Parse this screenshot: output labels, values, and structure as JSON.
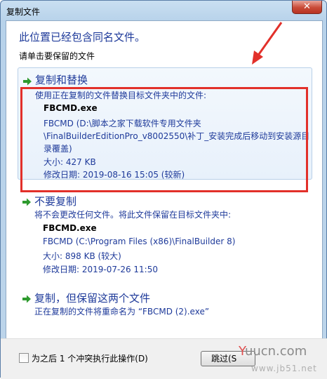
{
  "window": {
    "title": "复制文件",
    "close_glyph": "✕"
  },
  "heading": "此位置已经包含同名文件。",
  "subheading": "请单击要保留的文件",
  "options": [
    {
      "title": "复制和替换",
      "desc": "使用正在复制的文件替换目标文件夹中的文件:",
      "filename": "FBCMD.exe",
      "path_lines": [
        "FBCMD (D:\\脚本之家下载软件专用文件夹",
        "\\FinalBuilderEditionPro_v8002550\\补丁_安装完成后移动到安装源目",
        "录覆盖)"
      ],
      "size": "大小: 427 KB",
      "date": "修改日期: 2019-08-16 15:05 (较新)"
    },
    {
      "title": "不要复制",
      "desc": "将不会更改任何文件。将此文件保留在目标文件夹中:",
      "filename": "FBCMD.exe",
      "path_lines": [
        "FBCMD (C:\\Program Files (x86)\\FinalBuilder 8)"
      ],
      "size": "大小: 898 KB (较大)",
      "date": "修改日期: 2019-07-26 11:50"
    },
    {
      "title": "复制，但保留这两个文件",
      "desc": "正在复制的文件将重命名为 “FBCMD (2).exe”"
    }
  ],
  "footer": {
    "checkbox_label": "为之后 1 个冲突执行此操作(D)",
    "skip_button": "跳过(S"
  },
  "watermark": {
    "line1_y": "Y",
    "line1_rest": "uucn.com",
    "line2": "www.jb51.net"
  },
  "colors": {
    "accent": "#1e3a9a",
    "highlight_box": "#e2302a",
    "arrow_green": "#2e9a2e"
  }
}
